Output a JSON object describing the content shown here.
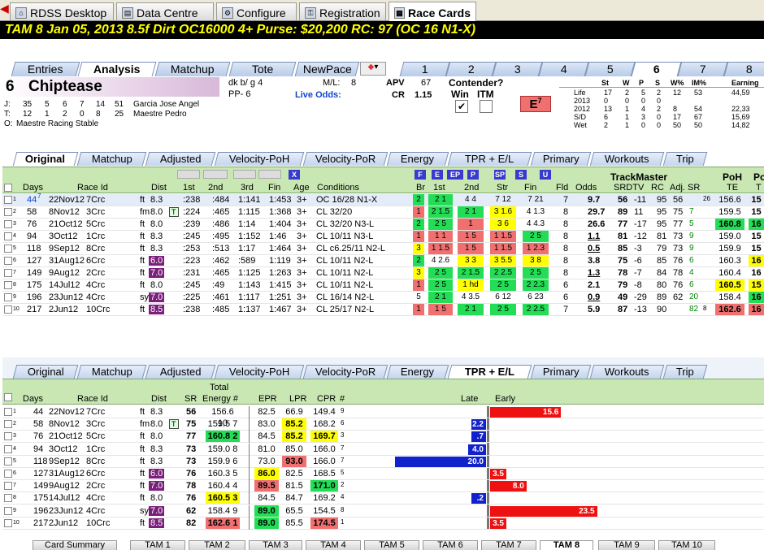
{
  "toptabs": [
    "RDSS Desktop",
    "Data Centre",
    "Configure",
    "Registration",
    "Race Cards"
  ],
  "header": "TAM  8   Jan 05, 2013          8.5f  Dirt   OC16000  4+   Purse: $20,200   RC: 97  (OC 16 N1-X)",
  "subtabs": [
    "Entries",
    "Analysis",
    "Matchup",
    "Tote",
    "NewPace"
  ],
  "postnums": [
    "1",
    "2",
    "3",
    "4",
    "5",
    "6",
    "7",
    "8"
  ],
  "horse": {
    "num": "6",
    "name": "Chiptease",
    "desc": "dk b/ g 4",
    "pp": "PP- 6",
    "ml_label": "M/L:",
    "ml": "8",
    "live_label": "Live Odds:",
    "apv_label": "APV",
    "apv": "67",
    "cr_label": "CR",
    "cr": "1.15",
    "contender": "Contender?",
    "win": "Win",
    "itm": "ITM",
    "e_label": "E",
    "e_val": "7",
    "check": "✔"
  },
  "jt": [
    {
      "k": "J:",
      "vals": [
        "35",
        "5",
        "6",
        "7",
        "14",
        "51"
      ],
      "name": "Garcia Jose Angel"
    },
    {
      "k": "T:",
      "vals": [
        "12",
        "1",
        "2",
        "0",
        "8",
        "25"
      ],
      "name": "Maestre Pedro"
    },
    {
      "k": "O:",
      "vals": [],
      "name": "Maestre Racing Stable"
    }
  ],
  "stats": {
    "heads": [
      "St",
      "W",
      "P",
      "S",
      "W%",
      "IM%",
      "Earning"
    ],
    "rows": [
      [
        "Life",
        "17",
        "2",
        "5",
        "2",
        "12",
        "53",
        "44,59"
      ],
      [
        "2013",
        "0",
        "0",
        "0",
        "0",
        "",
        "",
        ""
      ],
      [
        "2012",
        "13",
        "1",
        "4",
        "2",
        "8",
        "54",
        "22,33"
      ],
      [
        "S/D",
        "6",
        "1",
        "3",
        "0",
        "17",
        "67",
        "15,69"
      ],
      [
        "Wet",
        "2",
        "1",
        "0",
        "0",
        "50",
        "50",
        "14,82"
      ]
    ]
  },
  "gridtabs1": [
    "Original",
    "Matchup",
    "Adjusted",
    "Velocity-PoH",
    "Velocity-PoR",
    "Energy",
    "TPR + E/L",
    "Primary",
    "Workouts",
    "Trip"
  ],
  "grid1": {
    "heads": [
      "Days",
      "Race Id",
      "Dist",
      "1st",
      "2nd",
      "3rd",
      "Fin",
      "Age",
      "Conditions",
      "Br",
      "1st",
      "2nd",
      "Str",
      "Fin",
      "Fld",
      "Odds",
      "TrackMaster",
      "SRDTV",
      "RC",
      "Adj. SR",
      "PoH",
      "TE",
      "Po",
      "T"
    ],
    "flabs": [
      "F",
      "E",
      "EP",
      "P",
      "SP",
      "S",
      "U",
      "X"
    ],
    "rows": [
      [
        "1",
        "44",
        "7",
        "22Nov12",
        "7Crc",
        "ft",
        "8.3",
        "",
        ":23",
        "8",
        ":48",
        "4",
        "1:14",
        "1",
        "1:45",
        "3",
        "3+",
        "OC 16/28 N1-X",
        "2",
        "2",
        "1",
        "4",
        "4",
        "7",
        "12",
        "7",
        "21",
        "7",
        "9.7",
        "56",
        "-11",
        "95",
        "56",
        "",
        "26",
        "156.6",
        "15"
      ],
      [
        "2",
        "58",
        "",
        "8Nov12",
        "3Crc",
        "fm",
        "8.0",
        "T",
        ":22",
        "4",
        ":46",
        "5",
        "1:11",
        "5",
        "1:36",
        "8",
        "3+",
        "CL 32/20",
        "1",
        "2",
        "1.5",
        "2",
        "1",
        "3",
        "1.6",
        "4",
        "1.3",
        "8",
        "29.7",
        "89",
        "11",
        "95",
        "75",
        "7",
        "",
        "159.5",
        "15"
      ],
      [
        "3",
        "76",
        "",
        "21Oct12",
        "5Crc",
        "ft",
        "8.0",
        "",
        ":23",
        "9",
        ":48",
        "6",
        "1:14",
        "",
        "1:40",
        "4",
        "3+",
        "CL 32/20 N3-L",
        "2",
        "2",
        "5",
        "1",
        "",
        "3",
        "6",
        "4",
        "4.3",
        "8",
        "26.6",
        "77",
        "-17",
        "95",
        "77",
        "5",
        "",
        "160.8",
        "16"
      ],
      [
        "4",
        "94",
        "",
        "3Oct12",
        "1Crc",
        "ft",
        "8.3",
        "",
        ":24",
        "5",
        ":49",
        "5",
        "1:15",
        "2",
        "1:46",
        "",
        "3+",
        "CL 10/11 N3-L",
        "1",
        "1",
        "1",
        "1",
        "5",
        "1",
        "1.5",
        "2",
        "5",
        "8",
        "1.1",
        "81",
        "-12",
        "81",
        "73",
        "9",
        "",
        "159.0",
        "15"
      ],
      [
        "5",
        "118",
        "",
        "9Sep12",
        "8Crc",
        "ft",
        "8.3",
        "",
        ":25",
        "3",
        ":51",
        "3",
        "1:17",
        "",
        "1:46",
        "4",
        "3+",
        "CL c6.25/11 N2-L",
        "3",
        "1",
        "1.5",
        "1",
        "5",
        "1",
        "1.5",
        "1",
        "2.3",
        "8",
        "0.5",
        "85",
        "-3",
        "79",
        "73",
        "9",
        "",
        "159.9",
        "15"
      ],
      [
        "6",
        "127",
        "",
        "31Aug12",
        "6Crc",
        "ft",
        "6.0",
        "",
        ":22",
        "3",
        ":46",
        "2",
        ":58",
        "9",
        "1:11",
        "9",
        "3+",
        "CL 10/11 N2-L",
        "2",
        "4",
        "2.6",
        "3",
        "3",
        "3",
        "5.5",
        "3",
        "8",
        "8",
        "3.8",
        "75",
        "-6",
        "85",
        "76",
        "6",
        "",
        "160.3",
        "16"
      ],
      [
        "7",
        "149",
        "",
        "9Aug12",
        "2Crc",
        "ft",
        "7.0",
        "",
        ":23",
        "1",
        ":46",
        "5",
        "1:12",
        "5",
        "1:26",
        "3",
        "3+",
        "CL 10/11 N2-L",
        "3",
        "2",
        "5",
        "2",
        "1.5",
        "2",
        "2.5",
        "2",
        "5",
        "8",
        "1.3",
        "78",
        "-7",
        "84",
        "78",
        "4",
        "",
        "160.4",
        "16"
      ],
      [
        "8",
        "175",
        "",
        "14Jul12",
        "4Crc",
        "ft",
        "8.0",
        "",
        ":24",
        "5",
        ":49",
        "",
        "1:14",
        "3",
        "1:41",
        "5",
        "3+",
        "CL 10/11 N2-L",
        "1",
        "2",
        "5",
        "1",
        "hd",
        "2",
        "5",
        "2",
        "2.3",
        "6",
        "2.1",
        "79",
        "-8",
        "80",
        "76",
        "6",
        "",
        "160.5",
        "15"
      ],
      [
        "9",
        "196",
        "",
        "23Jun12",
        "4Crc",
        "sy",
        "7.0",
        "",
        ":22",
        "5",
        ":46",
        "1",
        "1:11",
        "7",
        "1:25",
        "1",
        "3+",
        "CL 16/14 N2-L",
        "5",
        "2",
        "1",
        "4",
        "3.5",
        "6",
        "12",
        "6",
        "23",
        "6",
        "0.9",
        "49",
        "-29",
        "89",
        "62",
        "20",
        "",
        "158.4",
        "16"
      ],
      [
        "10",
        "217",
        "",
        "2Jun12",
        "10Crc",
        "ft",
        "8.5",
        "",
        ":23",
        "8",
        ":48",
        "5",
        "1:13",
        "7",
        "1:46",
        "7",
        "3+",
        "CL 25/17 N2-L",
        "1",
        "1",
        "5",
        "2",
        "1",
        "2",
        "5",
        "2",
        "2.5",
        "7",
        "5.9",
        "87",
        "-13",
        "90",
        "",
        "82",
        "8",
        "162.6",
        "16"
      ]
    ]
  },
  "gridtabs2": [
    "Original",
    "Matchup",
    "Adjusted",
    "Velocity-PoH",
    "Velocity-PoR",
    "Energy",
    "TPR + E/L",
    "Primary",
    "Workouts",
    "Trip"
  ],
  "grid2": {
    "heads": [
      "Days",
      "Race Id",
      "Dist",
      "SR",
      "Total",
      "Energy #",
      "EPR",
      "LPR",
      "CPR",
      "#",
      "Late",
      "Early"
    ],
    "rows": [
      [
        "1",
        "44",
        "22Nov12",
        "7Crc",
        "ft",
        "8.3",
        "",
        "56",
        "156.6",
        "10",
        "82.5",
        "66.9",
        "149.4",
        "9"
      ],
      [
        "2",
        "58",
        "8Nov12",
        "3Crc",
        "fm",
        "8.0",
        "T",
        "75",
        "159.5",
        "7",
        "83.0",
        "85.2",
        "168.2",
        "6"
      ],
      [
        "3",
        "76",
        "21Oct12",
        "5Crc",
        "ft",
        "8.0",
        "",
        "77",
        "160.8",
        "2",
        "84.5",
        "85.2",
        "169.7",
        "3"
      ],
      [
        "4",
        "94",
        "3Oct12",
        "1Crc",
        "ft",
        "8.3",
        "",
        "73",
        "159.0",
        "8",
        "81.0",
        "85.0",
        "166.0",
        "7"
      ],
      [
        "5",
        "118",
        "9Sep12",
        "8Crc",
        "ft",
        "8.3",
        "",
        "73",
        "159.9",
        "6",
        "73.0",
        "93.0",
        "166.0",
        "7"
      ],
      [
        "6",
        "127",
        "31Aug12",
        "6Crc",
        "ft",
        "6.0",
        "",
        "76",
        "160.3",
        "5",
        "86.0",
        "82.5",
        "168.5",
        "5"
      ],
      [
        "7",
        "149",
        "9Aug12",
        "2Crc",
        "ft",
        "7.0",
        "",
        "78",
        "160.4",
        "4",
        "89.5",
        "81.5",
        "171.0",
        "2"
      ],
      [
        "8",
        "175",
        "14Jul12",
        "4Crc",
        "ft",
        "8.0",
        "",
        "76",
        "160.5",
        "3",
        "84.5",
        "84.7",
        "169.2",
        "4"
      ],
      [
        "9",
        "196",
        "23Jun12",
        "4Crc",
        "sy",
        "7.0",
        "",
        "62",
        "158.4",
        "9",
        "89.0",
        "65.5",
        "154.5",
        "8"
      ],
      [
        "10",
        "217",
        "2Jun12",
        "10Crc",
        "ft",
        "8.5",
        "",
        "82",
        "162.6",
        "1",
        "89.0",
        "85.5",
        "174.5",
        "1"
      ]
    ],
    "bars": [
      {
        "v": "15.6",
        "dir": "early",
        "w": 15.6
      },
      {
        "v": "2.2",
        "dir": "late",
        "w": 2.2
      },
      {
        "v": ".7",
        "dir": "late",
        "w": 0.7
      },
      {
        "v": "4.0",
        "dir": "late",
        "w": 4.0
      },
      {
        "v": "20.0",
        "dir": "late",
        "w": 20.0
      },
      {
        "v": "3.5",
        "dir": "early",
        "w": 3.5
      },
      {
        "v": "8.0",
        "dir": "early",
        "w": 8.0
      },
      {
        "v": ".2",
        "dir": "late",
        "w": 0.2
      },
      {
        "v": "23.5",
        "dir": "early",
        "w": 23.5
      },
      {
        "v": "3.5",
        "dir": "early",
        "w": 3.5
      }
    ]
  },
  "bottomtabs": [
    "Card Summary",
    "TAM 1",
    "TAM 2",
    "TAM 3",
    "TAM 4",
    "TAM 5",
    "TAM 6",
    "TAM 7",
    "TAM 8",
    "TAM 9",
    "TAM 10"
  ],
  "colors": {
    "green": "#22dd55",
    "red": "#f07070",
    "yellow": "#ffff00",
    "purple": "#7a1f7a",
    "header_green": "#c9e7b3",
    "bar_red": "#ee1111",
    "bar_blue": "#1122cc"
  }
}
